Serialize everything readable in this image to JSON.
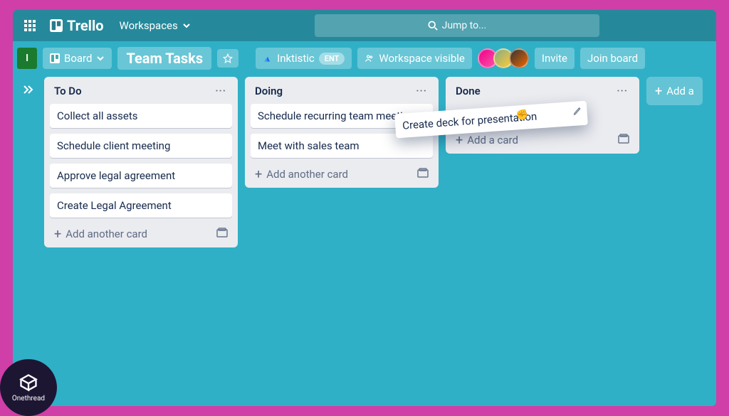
{
  "brand": "Trello",
  "workspaces_label": "Workspaces",
  "search_placeholder": "Jump to...",
  "user_initial": "I",
  "board_view_label": "Board",
  "board_title": "Team Tasks",
  "org_name": "Inktistic",
  "org_badge": "ENT",
  "visibility_label": "Workspace visible",
  "invite_label": "Invite",
  "join_label": "Join board",
  "add_list_label": "Add a",
  "lists": [
    {
      "title": "To Do",
      "cards": [
        "Collect all assets",
        "Schedule client meeting",
        "Approve legal agreement",
        "Create Legal Agreement"
      ],
      "add_label": "Add another card"
    },
    {
      "title": "Doing",
      "cards": [
        "Schedule recurring team meetings",
        "Meet with sales team"
      ],
      "add_label": "Add another card"
    },
    {
      "title": "Done",
      "cards": [],
      "add_label": "Add a card"
    }
  ],
  "dragged_card_text": "Create deck for presentation",
  "badge_brand": "Onethread"
}
